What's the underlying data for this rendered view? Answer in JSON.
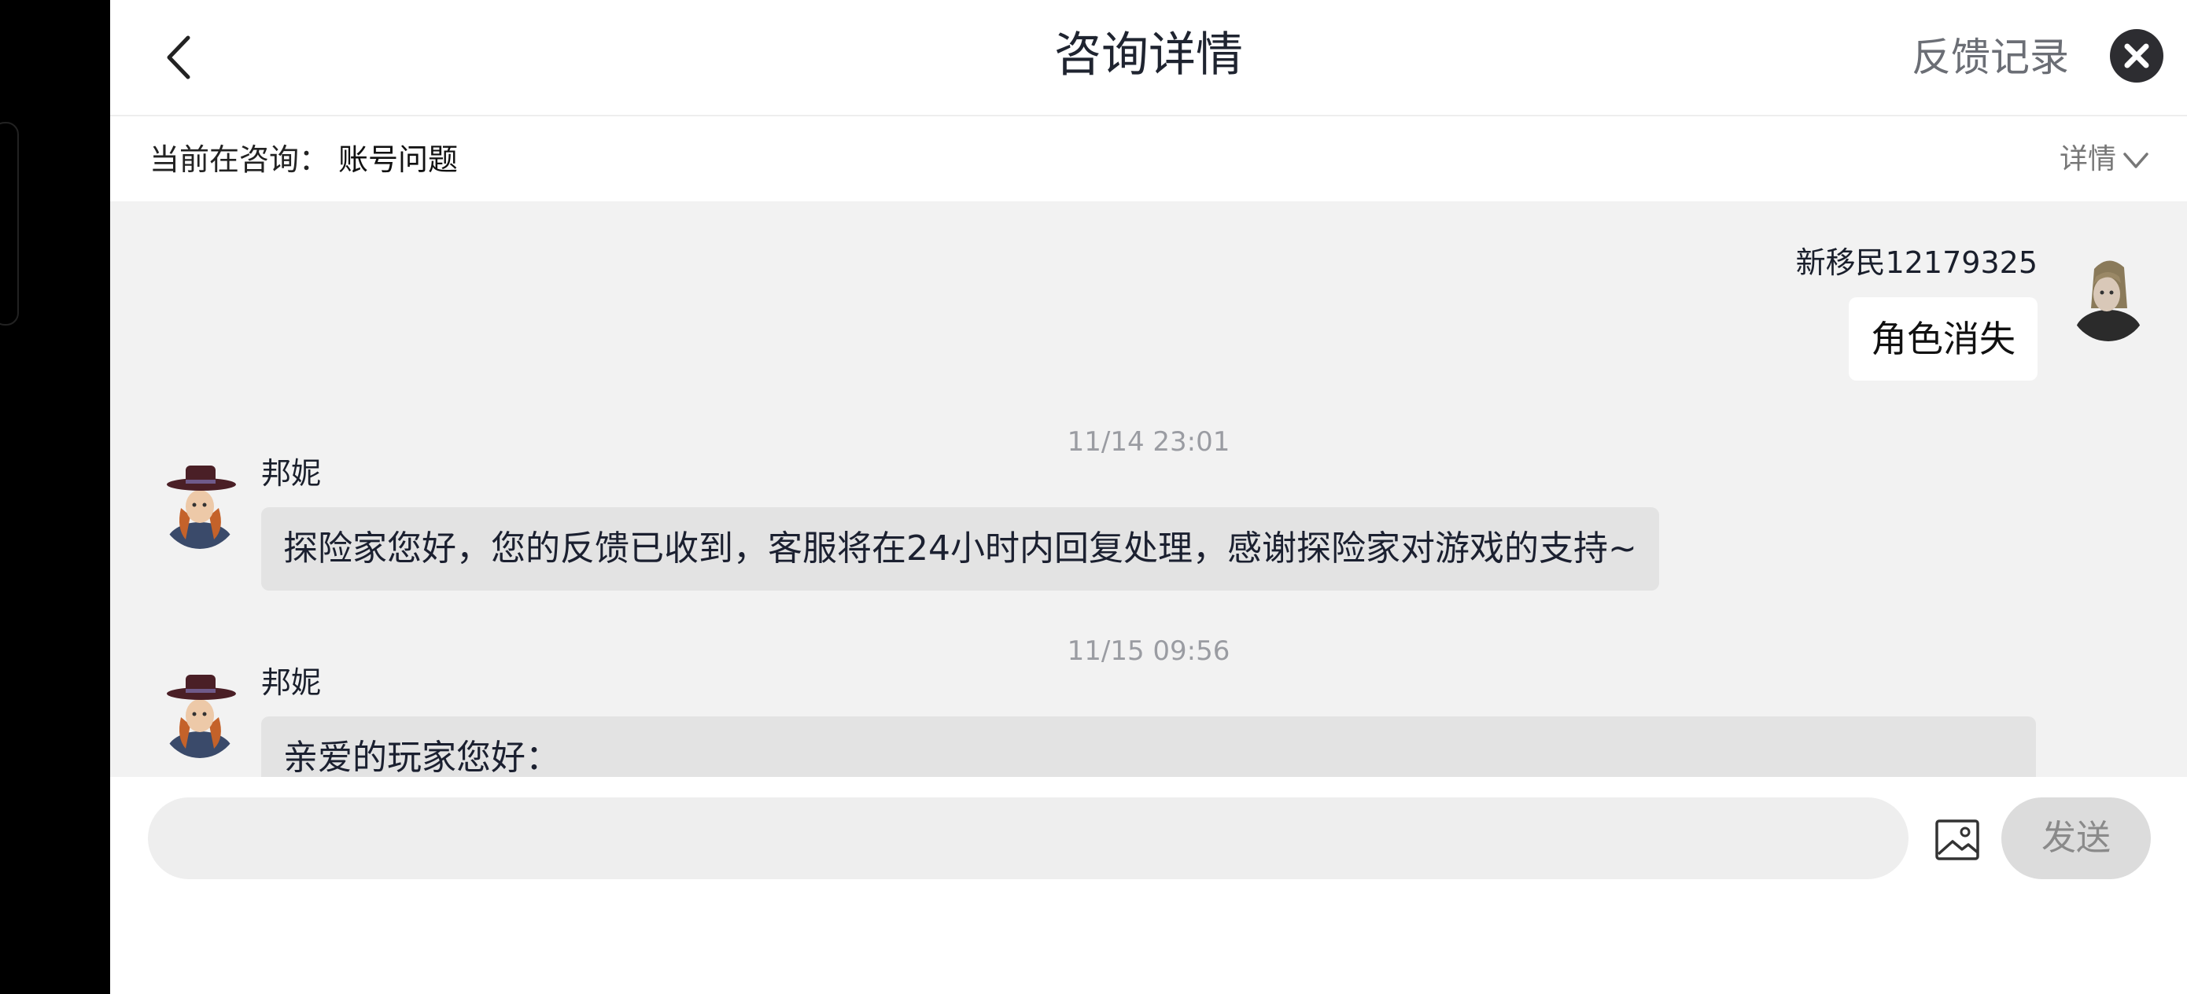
{
  "header": {
    "title": "咨询详情",
    "feedback_link": "反馈记录",
    "icons": [
      "chevron-left-icon",
      "close-icon"
    ]
  },
  "topic": {
    "label": "当前在咨询：",
    "value": "账号问题",
    "detail": "详情"
  },
  "messages": [
    {
      "sender": "新移民12179325",
      "side": "right",
      "text": "角色消失"
    },
    {
      "timestamp": "11/14 23:01"
    },
    {
      "sender": "邦妮",
      "side": "left",
      "text": "探险家您好，您的反馈已收到，客服将在24小时内回复处理，感谢探险家对游戏的支持~"
    },
    {
      "timestamp": "11/15 09:56"
    },
    {
      "sender": "邦妮",
      "side": "left",
      "text": "亲爱的玩家您好："
    }
  ],
  "input": {
    "placeholder": "",
    "send_label": "发送"
  },
  "colors": {
    "chat_bg": "#f2f2f2",
    "bubble_in": "#e3e3e3",
    "bubble_out": "#ffffff",
    "send_disabled": "#dcdcdc",
    "close_btn": "#2d2d31"
  }
}
